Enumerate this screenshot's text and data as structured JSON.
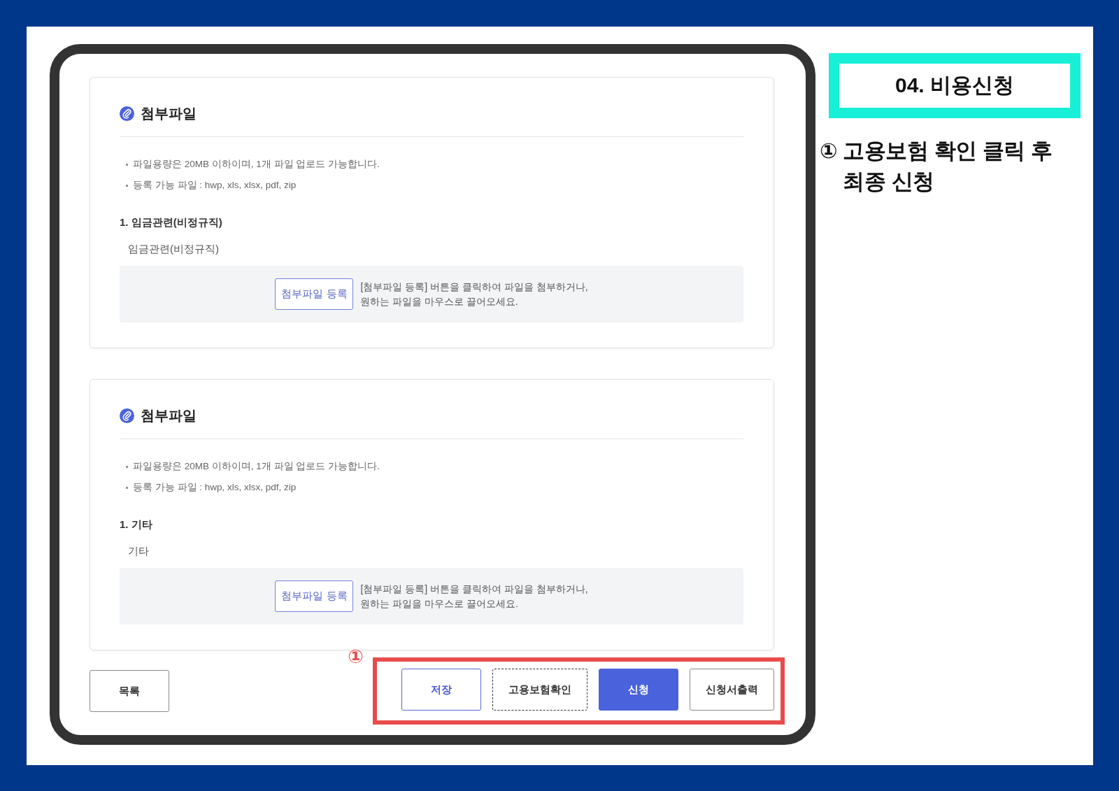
{
  "sections": [
    {
      "title": "첨부파일",
      "notes": [
        "파일용량은 20MB 이하이며, 1개 파일 업로드 가능합니다.",
        "등록 가능 파일 : hwp, xls, xlsx, pdf, zip"
      ],
      "item": {
        "label": "1. 임금관련(비정규직)",
        "name": "임금관련(비정규직)"
      },
      "upload_button": "첨부파일 등록",
      "drop_hint": "[첨부파일 등록] 버튼을 클릭하여 파일을 첨부하거나,\n원하는 파일을 마우스로 끌어오세요."
    },
    {
      "title": "첨부파일",
      "notes": [
        "파일용량은 20MB 이하이며, 1개 파일 업로드 가능합니다.",
        "등록 가능 파일 : hwp, xls, xlsx, pdf, zip"
      ],
      "item": {
        "label": "1. 기타",
        "name": "기타"
      },
      "upload_button": "첨부파일 등록",
      "drop_hint": "[첨부파일 등록] 버튼을 클릭하여 파일을 첨부하거나,\n원하는 파일을 마우스로 끌어오세요."
    }
  ],
  "actions": {
    "left": [
      {
        "label": "목록",
        "kind": "default",
        "focused": false
      }
    ],
    "highlight": {
      "marker": "①",
      "buttons": [
        {
          "label": "저장",
          "kind": "secondary",
          "focused": false
        },
        {
          "label": "고용보험확인",
          "kind": "default",
          "focused": true
        },
        {
          "label": "신청",
          "kind": "primary",
          "focused": false
        },
        {
          "label": "신청서출력",
          "kind": "default",
          "focused": false
        }
      ]
    }
  },
  "guide": {
    "title": "04. 비용신청",
    "note": {
      "marker": "①",
      "text": "고용보험 확인 클릭 후 최종 신청"
    }
  }
}
